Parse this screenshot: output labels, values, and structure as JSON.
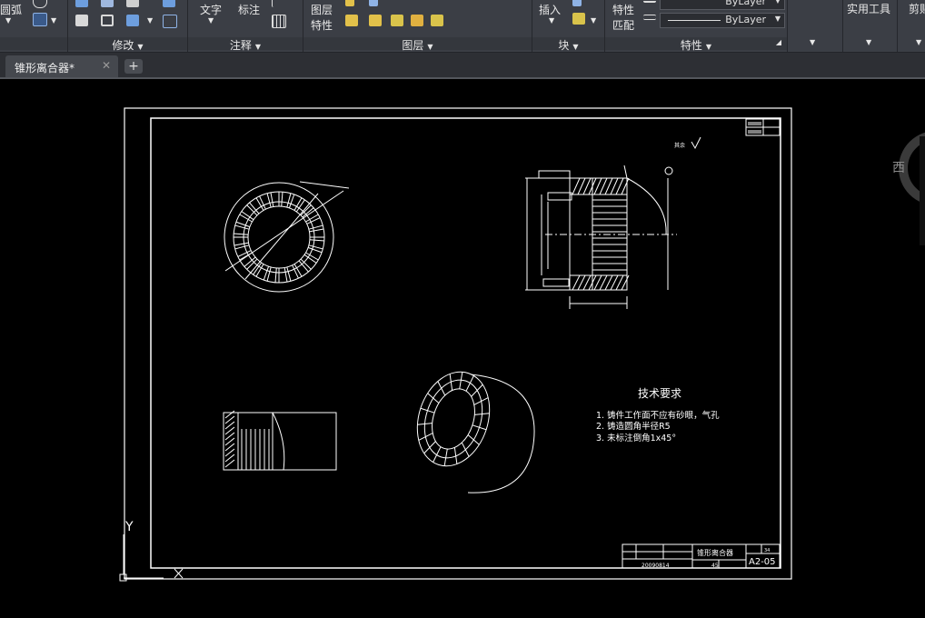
{
  "ribbon": {
    "arc_label": "圆弧",
    "modify": {
      "title": "修改"
    },
    "annotation": {
      "text_label": "文字",
      "dim_label": "标注",
      "title": "注释"
    },
    "layers": {
      "prop_label_1": "图层",
      "prop_label_2": "特性",
      "title": "图层"
    },
    "block": {
      "insert_label": "插入",
      "title": "块"
    },
    "properties": {
      "match_label_1": "特性",
      "match_label_2": "匹配",
      "color_value": "ByLayer",
      "linetype_value": "ByLayer",
      "title": "特性"
    },
    "utilities": {
      "label": "实用工具"
    },
    "clipboard": {
      "label": "剪贴"
    }
  },
  "tabs": [
    {
      "label": "锥形离合器*"
    }
  ],
  "viewcube": {
    "west_label": "西"
  },
  "drawing": {
    "tech_title": "技术要求",
    "tech_items": [
      "1. 铸件工作面不应有砂眼，气孔",
      "2. 铸造圆角半径R5",
      "3. 未标注倒角1x45°"
    ],
    "roughness_label": "其余",
    "title_block": {
      "part_name": "锥形离合器",
      "drawing_no": "A2-05",
      "student_no": "20090814",
      "material": "45",
      "scale": "1:1",
      "count": "34"
    }
  },
  "ucs": {
    "y_label": "Y",
    "x_label": "X"
  }
}
